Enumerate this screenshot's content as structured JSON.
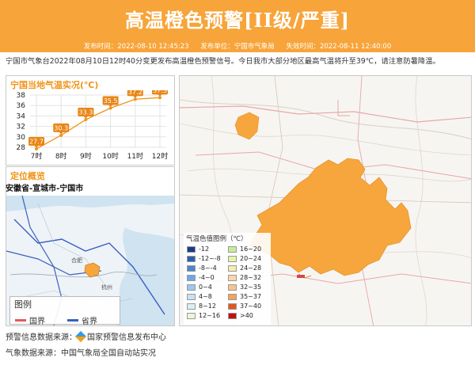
{
  "header": {
    "title": "高温橙色预警[II级/严重]",
    "issue_time": "发布时间：2022-08-10 12:45:23",
    "issuer": "发布单位：宁国市气象局",
    "expire_time": "失效时间：2022-08-11 12:40:00"
  },
  "description": "宁国市气象台2022年08月10日12时40分变更发布高温橙色预警信号。今日我市大部分地区最高气温将升至39℃，请注意防暑降温。",
  "temp_panel": {
    "title": "宁国当地气温实况(℃)"
  },
  "chart_data": {
    "type": "line",
    "categories": [
      "7时",
      "8时",
      "9时",
      "10时",
      "11时",
      "12时"
    ],
    "values": [
      27.7,
      30.3,
      33.3,
      35.5,
      37.2,
      37.5
    ],
    "title": "宁国当地气温实况(℃)",
    "xlabel": "",
    "ylabel": "",
    "ylim": [
      28,
      38
    ],
    "yticks": [
      28,
      30,
      32,
      34,
      36,
      38
    ],
    "grid": true,
    "line_color": "#f29318",
    "label_color": "#e98616"
  },
  "location_panel": {
    "title": "定位概览",
    "location": "安徽省-宣城市-宁国市",
    "legend_title": "图例",
    "legend_items": [
      {
        "label": "国界",
        "color": "#e05a5a"
      },
      {
        "label": "省界",
        "color": "#3b5fc0"
      }
    ],
    "city_labels": [
      "合肥",
      "杭州"
    ]
  },
  "temperature_legend": {
    "title": "气温色值图例（℃）",
    "items": [
      {
        "label": "-12",
        "color": "#1a3a8a"
      },
      {
        "label": "16~20",
        "color": "#c8ec9c"
      },
      {
        "label": "-12~-8",
        "color": "#2d5fb0"
      },
      {
        "label": "20~24",
        "color": "#e6f5a8"
      },
      {
        "label": "-8~-4",
        "color": "#4a86d0"
      },
      {
        "label": "24~28",
        "color": "#f6ecb0"
      },
      {
        "label": "-4~0",
        "color": "#6ea8e4"
      },
      {
        "label": "28~32",
        "color": "#f7d9a8"
      },
      {
        "label": "0~4",
        "color": "#9cc8f0"
      },
      {
        "label": "32~35",
        "color": "#f7c48a"
      },
      {
        "label": "4~8",
        "color": "#c4e2f8"
      },
      {
        "label": "35~37",
        "color": "#f3a35c"
      },
      {
        "label": "8~12",
        "color": "#d9f0f0"
      },
      {
        "label": "37~40",
        "color": "#e2571e"
      },
      {
        "label": "12~16",
        "color": "#e9f7d6"
      },
      {
        "label": ">40",
        "color": "#c11010"
      }
    ]
  },
  "footer": {
    "warning_source": "预警信息数据来源：",
    "warning_center": "国家预警信息发布中心",
    "weather_source": "气象数据来源：中国气象局全国自动站实况"
  },
  "colors": {
    "banner": "#f7a43a",
    "accent": "#f29318",
    "region_fill": "#f6a63c"
  }
}
